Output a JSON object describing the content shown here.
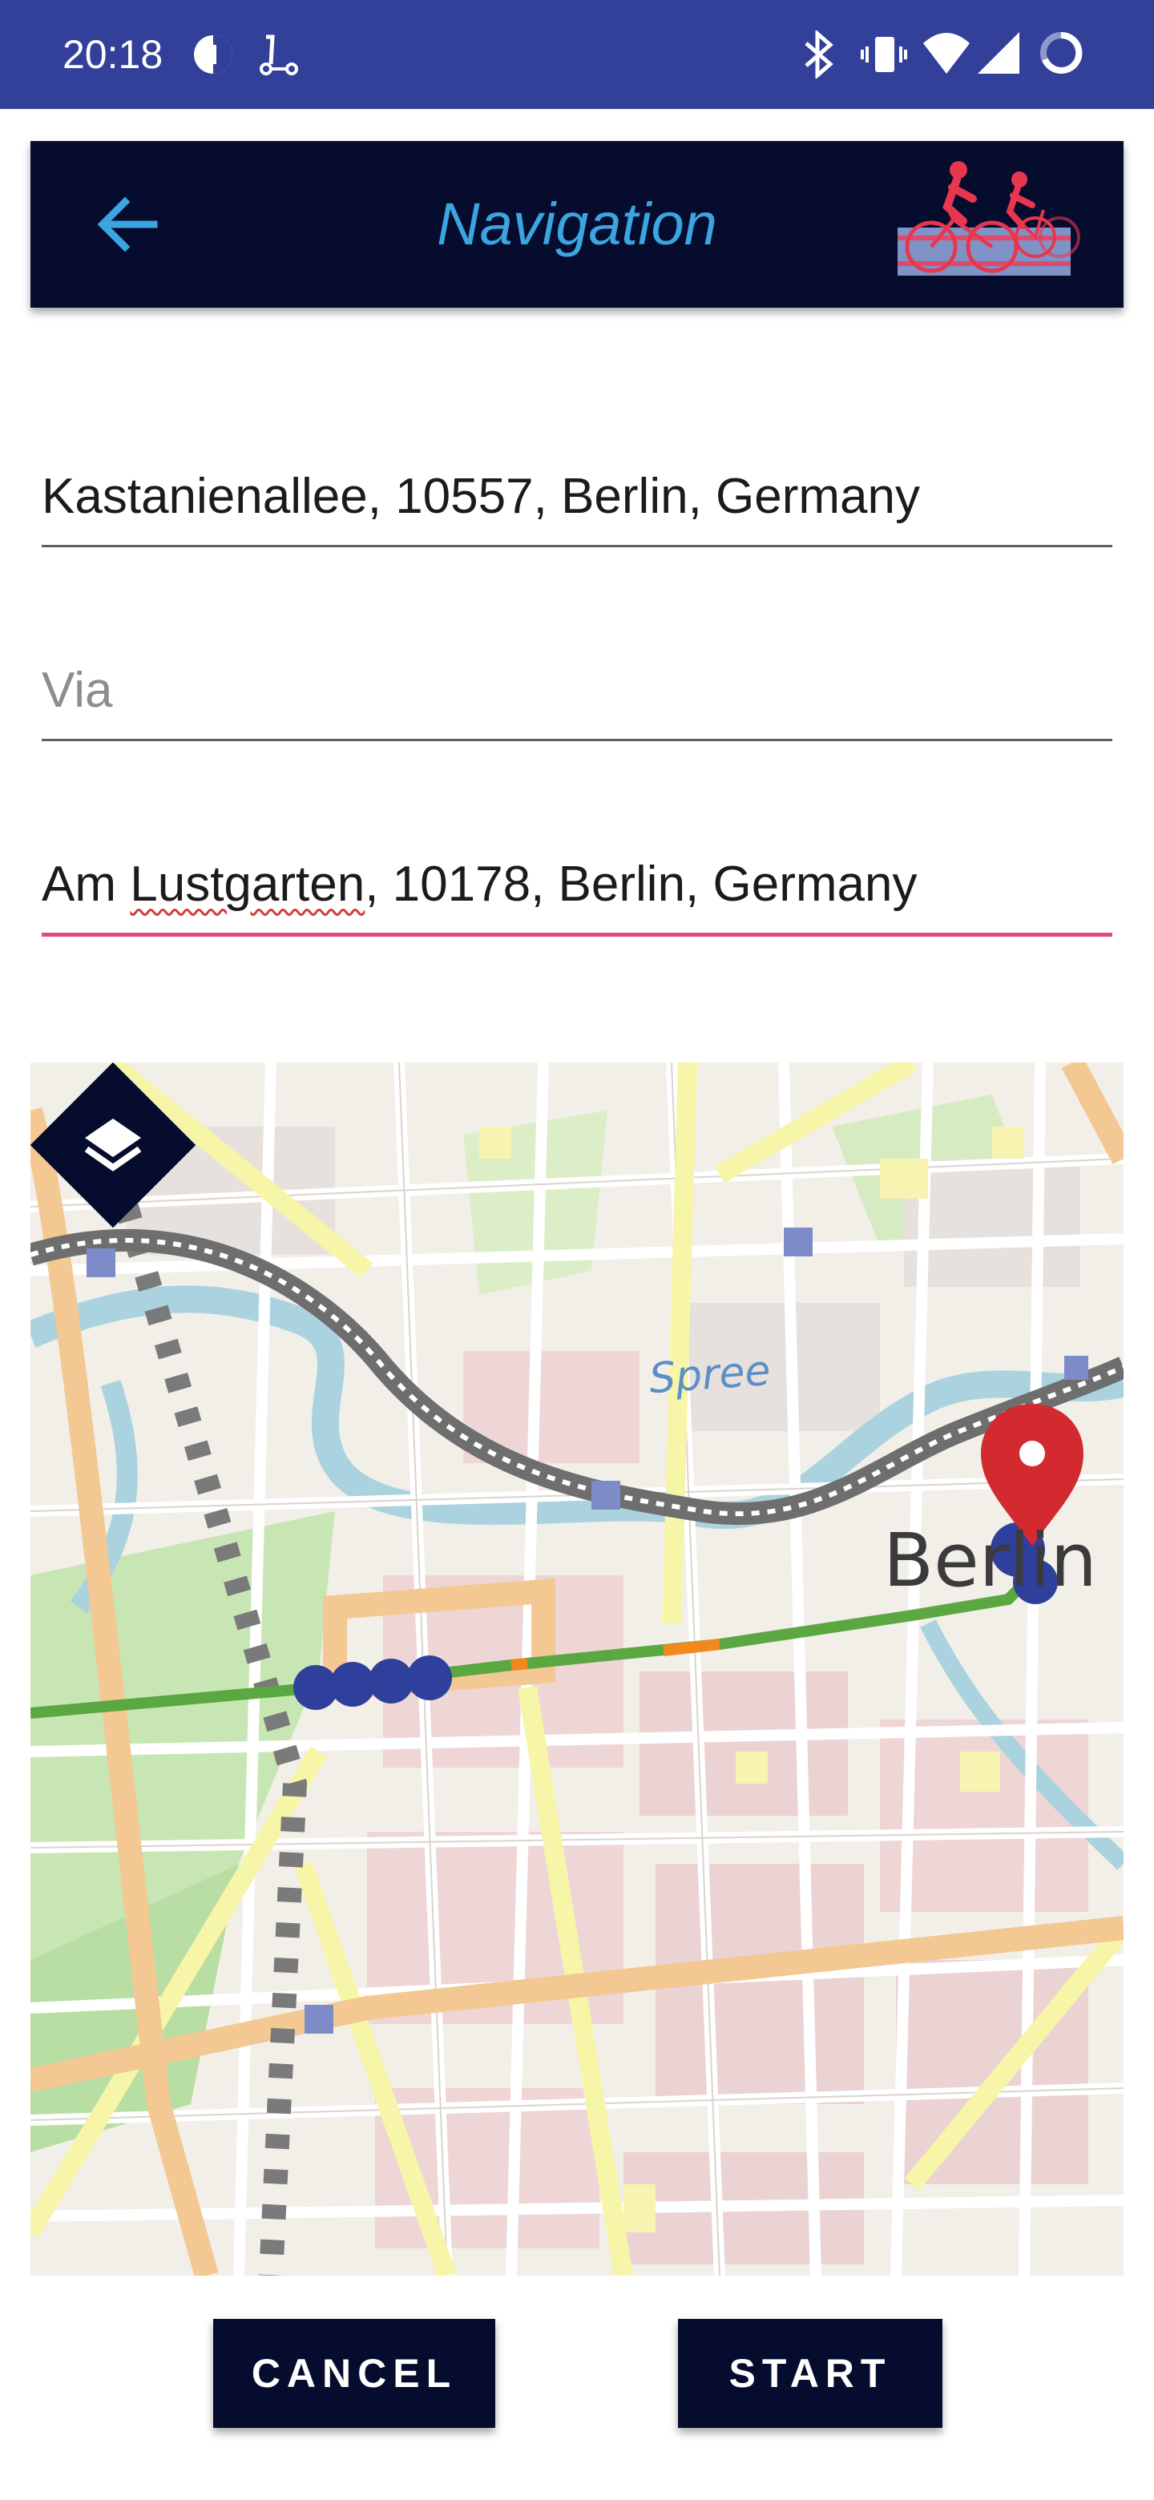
{
  "status_bar": {
    "time": "20:18",
    "left_icons": [
      "data-saver-icon",
      "scooter-icon"
    ],
    "right_icons": [
      "bluetooth-icon",
      "vibrate-icon",
      "wifi-icon",
      "signal-icon",
      "battery-ring-icon"
    ]
  },
  "toolbar": {
    "title": "Navigation",
    "back_icon": "arrow-left-icon",
    "logo_icon": "tandem-bike-logo"
  },
  "form": {
    "from": {
      "value": "Kastanienallee, 10557, Berlin, Germany",
      "placeholder": ""
    },
    "via": {
      "value": "",
      "placeholder": "Via"
    },
    "to": {
      "value_misspelled": "Lustgarten",
      "value_prefix": "Am ",
      "value_suffix": ", 10178, Berlin, Germany"
    }
  },
  "map": {
    "labels": {
      "river": "Spree",
      "city": "Berlin"
    },
    "layers_icon": "layers-icon",
    "colors": {
      "route_green": "#5ba741",
      "route_orange": "#f2891f",
      "waypoint": "#2f3f9c",
      "pin": "#d22a2f"
    }
  },
  "buttons": {
    "cancel": "CANCEL",
    "start": "START"
  },
  "colors": {
    "status_bar": "#33409a",
    "toolbar": "#050c2e",
    "title": "#3aa5e0",
    "focus_line": "#e24a77"
  }
}
